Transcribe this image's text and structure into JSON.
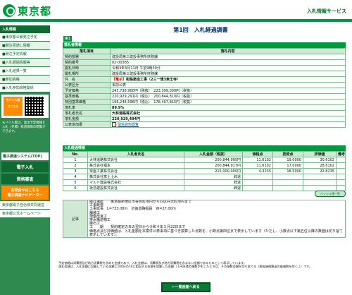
{
  "header": {
    "logo_text": "東京都",
    "service_name": "入札情報サービス"
  },
  "sidebar": {
    "heading": "入札情報",
    "items": [
      {
        "label": "■東京都公報発注予定"
      },
      {
        "label": "■発注見通し情報"
      },
      {
        "label": "■発注予定情報"
      },
      {
        "label": "■入札経過情報等"
      },
      {
        "label": "■入札結果一覧"
      },
      {
        "label": "■参加資格"
      },
      {
        "label": "■入札参加資格関係"
      }
    ],
    "mobile_label": "モバイル版",
    "mobile_sub": "はこちら",
    "note": "モバイル版は、発注予定情報と入札（見積）経過情報の閲覧ができます。",
    "system_label": "電子調達システム(TOP)",
    "electronic_bid": "電子入札",
    "qualification": "資格審査",
    "orange_label": "お問合せはこちら",
    "orange_sub": "電子調達ナビゲーター",
    "link1": "東京都電子自治体共同運営",
    "link2": "東京都公式ホームページ"
  },
  "page": {
    "title": "第1回　入札経過調書",
    "tab": "第1回"
  },
  "bid_info": {
    "section": "落札者情報",
    "col_item": "落札項目",
    "col_content": "落札内容",
    "rows": [
      {
        "label": "契約部署",
        "value": "建設局第三建設事務所庶務課"
      },
      {
        "label": "契約番号",
        "value": "02-00385"
      },
      {
        "label": "開札日時",
        "value": "令和3年3月11日 午前9時30分"
      },
      {
        "label": "開札場所",
        "value": "建設局第三建設事務所庶務課"
      },
      {
        "label": "件　名",
        "warn": "【電子】",
        "value": "街路築造工事（2三一環3東王寺）"
      },
      {
        "label": "公表区分",
        "value": "事前公表"
      },
      {
        "label": "予定価格",
        "value": "245,738,900円（税抜）　223,399,000円（税抜）"
      },
      {
        "label": "基準価格",
        "value": "220,929,291円（税込）　200,844,810円（税抜）"
      },
      {
        "label": "特別基準価格",
        "value": "196,248,596円（税込）　178,407,815円（税抜）"
      },
      {
        "label": "落札率",
        "value": "89.9%"
      },
      {
        "label": "落札者氏名",
        "value": "大林道路株式会社"
      },
      {
        "label": "落札金額",
        "value": "220,929,494円"
      },
      {
        "label": "公表追加書",
        "value": "関係資料閲覧"
      }
    ]
  },
  "bidders": {
    "section": "入札経過情報",
    "headers": [
      "No.",
      "入札者氏名",
      "入札金額（税抜）",
      "価格点",
      "技術点",
      "評価値",
      "備考"
    ],
    "rows": [
      {
        "no": "1",
        "name": "大林道路株式会社",
        "amount": "200,844,995円",
        "price": "11.6102",
        "tech": "19.0000",
        "eval": "30.6102",
        "note": ""
      },
      {
        "no": "2",
        "name": "株式会社福永",
        "amount": "200,844,917円",
        "price": "11.6102",
        "tech": "17.0000",
        "eval": "28.6102",
        "note": ""
      },
      {
        "no": "3",
        "name": "常盤工業株式会社",
        "amount": "215,000,000円",
        "price": "4.3235",
        "tech": "18.5000",
        "eval": "22.8235",
        "note": ""
      },
      {
        "no": "4",
        "name": "株式会社富士土木",
        "amount": "辞退",
        "price": "",
        "tech": "",
        "eval": "",
        "note": ""
      },
      {
        "no": "5",
        "name": "マルト建設株式会社",
        "amount": "辞退",
        "price": "",
        "tech": "",
        "eval": "",
        "note": ""
      },
      {
        "no": "6",
        "name": "坂島建設株式会社",
        "amount": "辞退",
        "price": "",
        "tech": "",
        "eval": "",
        "note": ""
      }
    ],
    "hash_button": "ハッシュ値一覧",
    "remarks_label": "記事",
    "remarks": [
      "履行場所　　東京都新宿区市谷台町地内から同区弁天町地内まで",
      "工事概要",
      "工事延長　L=733.08m　計画道路幅員　W=27.00ｍ",
      "舗装工",
      "地盤改良工",
      "排水構造物工",
      "縁石工",
      "工　　期　　契約確定の日の翌日から令和４年２月22日まで",
      "価格点及び評価値は、入札金額を本案件公表事項に基づき換算した点数を、小数点第四位まで表示しています（ただし、小数点以下第五位以降の数値は切り捨て表示しています）。"
    ]
  },
  "footnotes": [
    "予定価格は消費税及び地方消費税を含めた金額であり、入札金額は、消費税及び地方消費税を含まない金額であるものとして表示しています。",
    "落札金額は、入札金額に記載している金額に100分の10に相当する金額を加算した金額（１円未満の端数が生じたときは、その端数金額を切り捨てる（税抜価格算出の後端数を除く。））です。"
  ],
  "back_button": "←一覧画面へ戻る"
}
